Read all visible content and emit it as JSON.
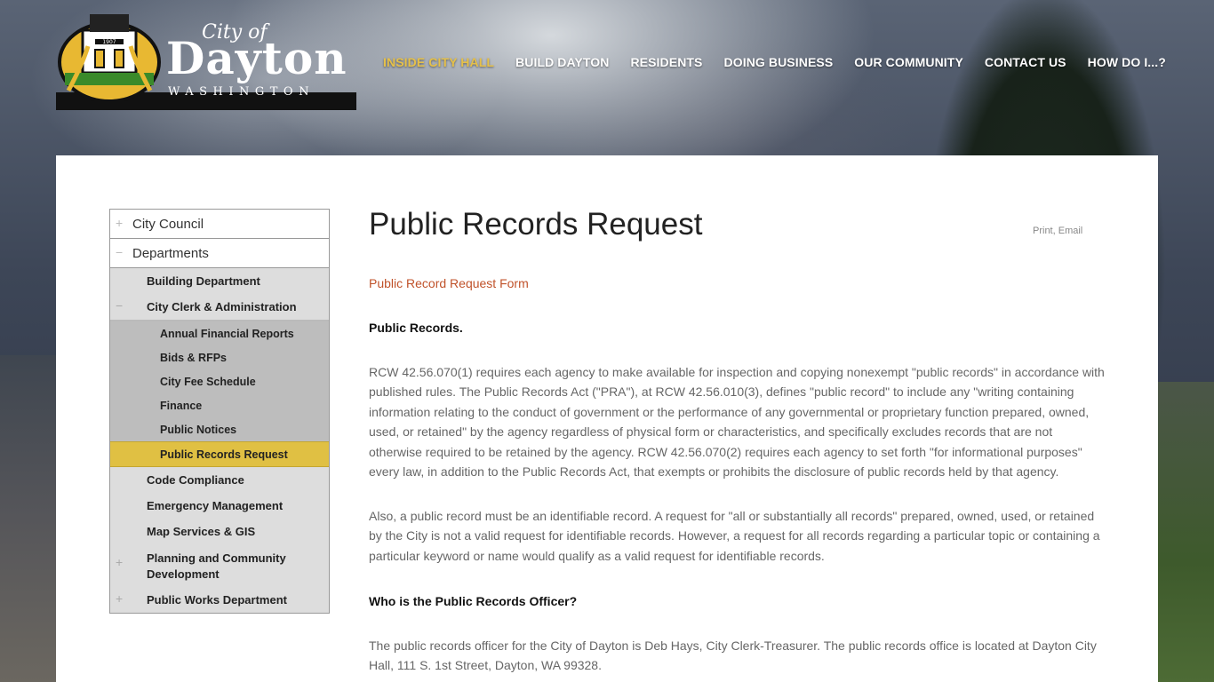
{
  "brand": {
    "city_of": "City of",
    "name": "Dayton",
    "state": "WASHINGTON",
    "seal_year": "1907",
    "accent_color": "#e5c04a"
  },
  "nav": [
    {
      "label": "INSIDE CITY HALL",
      "active": true
    },
    {
      "label": "BUILD DAYTON"
    },
    {
      "label": "RESIDENTS"
    },
    {
      "label": "DOING BUSINESS"
    },
    {
      "label": "OUR COMMUNITY"
    },
    {
      "label": "CONTACT US"
    },
    {
      "label": "HOW DO I...?"
    }
  ],
  "sidebar": {
    "top": [
      {
        "label": "City Council",
        "symbol": "+"
      },
      {
        "label": "Departments",
        "symbol": "−"
      }
    ],
    "departments": [
      {
        "label": "Building Department"
      },
      {
        "label": "City Clerk & Administration",
        "symbol": "−"
      },
      {
        "label": "Code Compliance"
      },
      {
        "label": "Emergency Management"
      },
      {
        "label": "Map Services & GIS"
      },
      {
        "label": "Planning and Community Development",
        "symbol": "+"
      },
      {
        "label": "Public Works Department",
        "symbol": "+"
      }
    ],
    "clerk_children": [
      {
        "label": "Annual Financial Reports"
      },
      {
        "label": "Bids & RFPs"
      },
      {
        "label": "City Fee Schedule"
      },
      {
        "label": "Finance"
      },
      {
        "label": "Public Notices"
      },
      {
        "label": "Public Records Request",
        "active": true
      }
    ]
  },
  "content": {
    "title": "Public Records Request",
    "print_email": "Print, Email",
    "form_link": "Public Record Request Form",
    "heading_public_records": "Public Records.",
    "paragraph_1": "RCW 42.56.070(1) requires each agency to make available for inspection and copying nonexempt \"public records\" in accordance with published rules. The Public Records Act (\"PRA\"), at RCW 42.56.010(3), defines \"public record\" to include any \"writing containing information relating to the conduct of government or the performance of any governmental or proprietary function prepared, owned, used, or retained\" by the agency regardless of physical form or characteristics, and specifically excludes records that are not otherwise required to be retained by the agency. RCW 42.56.070(2) requires each agency to set forth \"for informational purposes\" every law, in addition to the Public Records Act, that exempts or prohibits the disclosure of public records held by that agency.",
    "paragraph_2": "Also, a public record must be an identifiable record.  A request for \"all or substantially all records\" prepared, owned, used, or retained by the City is not a valid request for identifiable records.  However, a request for all records regarding a particular topic or containing a particular keyword or name would qualify as a valid request for identifiable records.",
    "heading_officer": "Who is the Public Records Officer?",
    "paragraph_3": "The public records officer for the City of Dayton is Deb Hays, City Clerk-Treasurer.  The public records office is located at Dayton City Hall, 111 S. 1st Street, Dayton, WA 99328."
  }
}
